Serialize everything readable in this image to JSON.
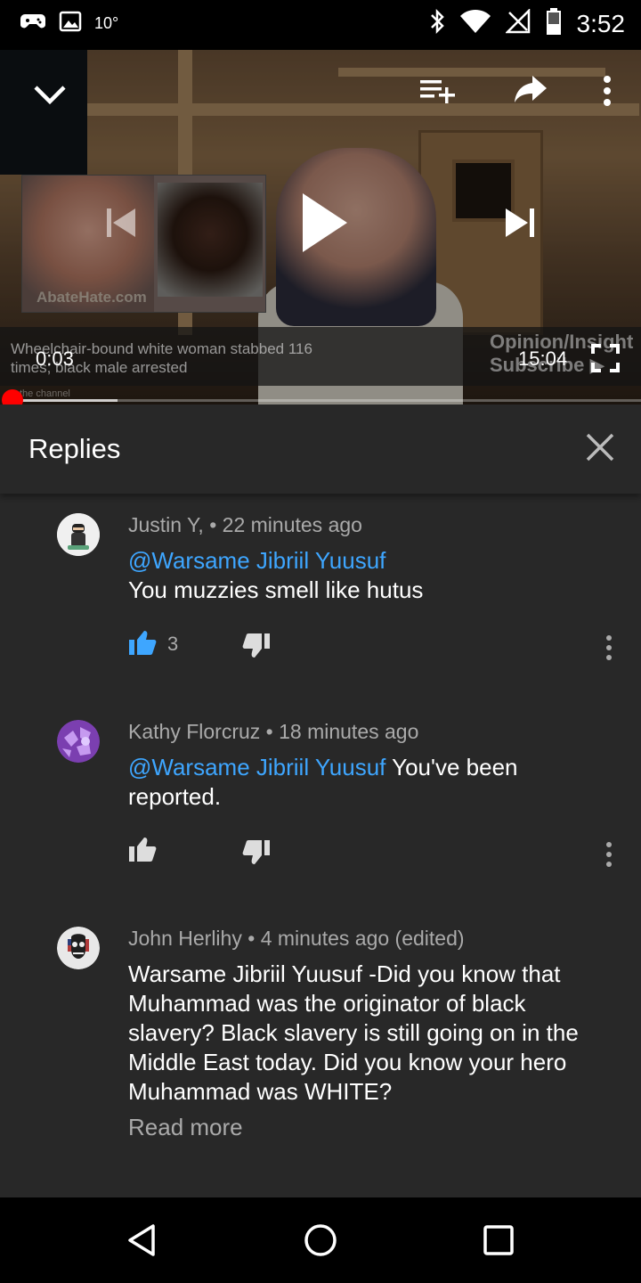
{
  "status_bar": {
    "temperature": "10°",
    "time": "3:52",
    "icons": [
      "game-controller-icon",
      "image-icon",
      "bluetooth-icon",
      "wifi-icon",
      "no-signal-icon",
      "battery-icon"
    ]
  },
  "player": {
    "video_title": "Wheelchair-bound white woman stabbed 116 times; black male arrested",
    "watermark_left": "AbateHate.com",
    "watermark_right_line1": "Opinion/Insight",
    "watermark_right_line2": "Subscribe ▶",
    "channel_hint": "the channel",
    "current_time": "0:03",
    "duration": "15:04",
    "progress_fraction": 0.003,
    "buffered_fraction": 0.17,
    "accent_color": "#ff0000",
    "icons": {
      "collapse": "chevron-down-icon",
      "add_to_playlist": "playlist-add-icon",
      "share": "share-icon",
      "more": "more-vertical-icon",
      "previous": "skip-previous-icon",
      "play": "play-icon",
      "next": "skip-next-icon",
      "fullscreen": "fullscreen-icon"
    }
  },
  "replies": {
    "title": "Replies",
    "close_icon": "close-icon",
    "comments": [
      {
        "author": "Justin Y,",
        "time": "22 minutes ago",
        "mention": "@Warsame Jibriil Yuusuf",
        "text": "You muzzies smell like hutus",
        "likes": "3",
        "liked": true
      },
      {
        "author": "Kathy Florcruz",
        "time": "18 minutes ago",
        "mention": "@Warsame Jibriil Yuusuf",
        "text": " You've been reported.",
        "likes": "",
        "liked": false
      },
      {
        "author": "John Herlihy",
        "time": "4 minutes ago (edited)",
        "mention": "",
        "text": "Warsame Jibriil Yuusuf -Did you know that Muhammad was the originator of black slavery?  Black slavery is still going on in the Middle East today.  Did you know your hero Muhammad was WHITE?",
        "read_more": "Read more"
      }
    ],
    "link_color": "#3ea6ff",
    "background": "#282828"
  },
  "nav_bar": {
    "back": "back-triangle-icon",
    "home": "home-circle-icon",
    "recents": "recents-square-icon"
  }
}
